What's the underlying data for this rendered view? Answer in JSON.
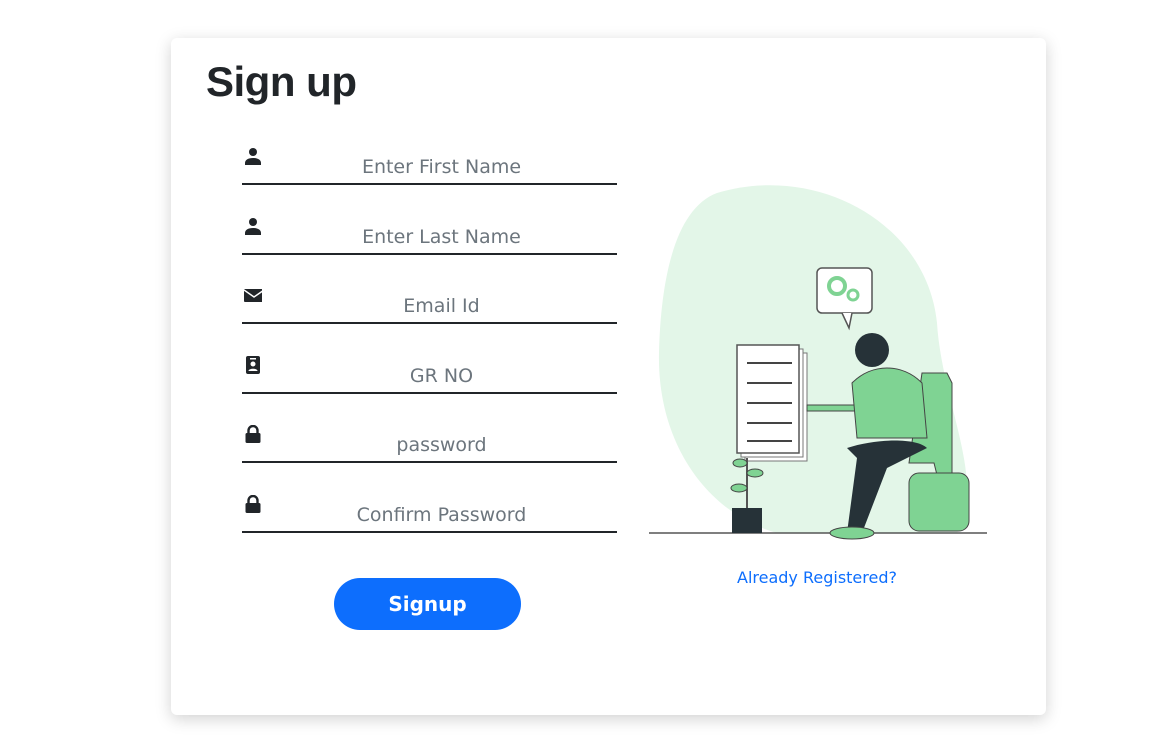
{
  "title": "Sign up",
  "fields": [
    {
      "icon": "user-icon",
      "placeholder": "Enter First Name",
      "value": ""
    },
    {
      "icon": "user-icon",
      "placeholder": "Enter Last Name",
      "value": ""
    },
    {
      "icon": "envelope-icon",
      "placeholder": "Email Id",
      "value": ""
    },
    {
      "icon": "id-badge-icon",
      "placeholder": "GR NO",
      "value": ""
    },
    {
      "icon": "lock-icon",
      "placeholder": "password",
      "value": ""
    },
    {
      "icon": "lock-icon",
      "placeholder": "Confirm Password",
      "value": ""
    }
  ],
  "signup_label": "Signup",
  "already_registered": "Already Registered?",
  "colors": {
    "accent": "#0d6efd",
    "illustration_green": "#7fd393",
    "blob": "#e3f6e8"
  }
}
